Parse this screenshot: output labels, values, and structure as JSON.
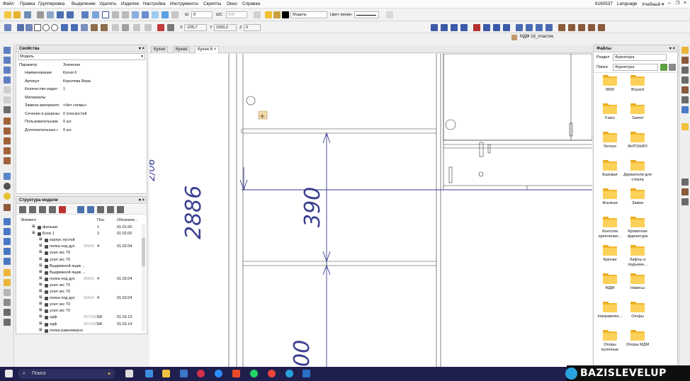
{
  "menu": {
    "items": [
      "Файл",
      "Правка",
      "Группировка",
      "Выделение",
      "Удалить",
      "Изделие",
      "Настройка",
      "Инструменты",
      "Скрипты",
      "Окно",
      "Справка"
    ],
    "license": "6160537",
    "language": "Language",
    "mode": "Учебный",
    "mode_arrow": "▾"
  },
  "toolbar1": {
    "line_width": "8",
    "step_label": "ШС",
    "step_value": "100",
    "layer": "Модель",
    "line_color_label": "Цвет линии"
  },
  "toolbar2": {
    "x_label": "X",
    "x_value": "-225,7",
    "y_label": "Y",
    "y_value": "1593,2",
    "z_label": "Z",
    "z_value": "0",
    "material": "МДФ 18_пластик"
  },
  "properties": {
    "title": "Свойства",
    "selector": "Модель",
    "col_param": "Параметр",
    "col_value": "Значение",
    "rows": [
      {
        "name": "Наименование",
        "value": "Кухня 6"
      },
      {
        "name": "Артикул",
        "value": "Королева Вера"
      },
      {
        "name": "Количество издел",
        "value": "1"
      },
      {
        "name": "Материалы",
        "value": ""
      },
      {
        "name": "Замена материало",
        "value": "<Нет схемы>"
      },
      {
        "name": "Сечения и разрезы",
        "value": "0 плоскостей"
      },
      {
        "name": "Пользовательские",
        "value": "0 шт."
      },
      {
        "name": "Дополнительные г",
        "value": "0 шт."
      }
    ]
  },
  "structure": {
    "title": "Структура модели",
    "col_element": "Элемент",
    "col_pos": "Поз.",
    "col_code": "Обозначе...",
    "rows": [
      {
        "name": "фальши",
        "size": "",
        "qty": "1",
        "code": "01.01.00",
        "indent": 1
      },
      {
        "name": "Блок 1",
        "size": "",
        "qty": "2",
        "code": "01.02.00",
        "indent": 1
      },
      {
        "name": "корпус пустой",
        "size": "",
        "qty": "",
        "code": "",
        "indent": 2
      },
      {
        "name": "полка под дух",
        "size": "568x5",
        "qty": "4",
        "code": "01.02.04",
        "indent": 2
      },
      {
        "name": "усил экс 70",
        "size": "",
        "qty": "",
        "code": "",
        "indent": 2
      },
      {
        "name": "усил экс 70",
        "size": "",
        "qty": "",
        "code": "",
        "indent": 2
      },
      {
        "name": "Выдвижной ящик ...",
        "size": "",
        "qty": "",
        "code": "",
        "indent": 2
      },
      {
        "name": "Выдвижной ящик ...",
        "size": "",
        "qty": "",
        "code": "",
        "indent": 2
      },
      {
        "name": "полка под дух",
        "size": "568x5",
        "qty": "4",
        "code": "01.02.04",
        "indent": 2
      },
      {
        "name": "усил экс 70",
        "size": "",
        "qty": "",
        "code": "",
        "indent": 2
      },
      {
        "name": "усил экс 70",
        "size": "",
        "qty": "",
        "code": "",
        "indent": 2
      },
      {
        "name": "полка под дух",
        "size": "568x5",
        "qty": "4",
        "code": "01.02.04",
        "indent": 2
      },
      {
        "name": "усил экс 70",
        "size": "",
        "qty": "",
        "code": "",
        "indent": 2
      },
      {
        "name": "усил экс 70",
        "size": "",
        "qty": "",
        "code": "",
        "indent": 2
      },
      {
        "name": "хдф",
        "size": "837x589x4",
        "qty": "13",
        "code": "01.02.13",
        "indent": 2
      },
      {
        "name": "хдф",
        "size": "567x589x4",
        "qty": "14",
        "code": "01.02.14",
        "indent": 2
      },
      {
        "name": "полки равномерно",
        "size": "",
        "qty": "",
        "code": "",
        "indent": 2
      }
    ]
  },
  "tabs": [
    "Кухня",
    "Кухня",
    "Кухня 6"
  ],
  "tab_close": "×",
  "drawing": {
    "dim_large": "2886",
    "dim_center": "390",
    "dim_bottom": "00",
    "dim_cut": "2/06"
  },
  "files": {
    "title": "Файлы",
    "section_label": "Раздел",
    "section_value": "Фурнитура",
    "folder_label": "Папка",
    "folder_value": "Фурнитура",
    "folders": [
      "0600",
      "Boyard",
      "Falso",
      "Samet",
      "Sensys",
      "АНТОНИО",
      "Базовая",
      "Держатели для стекла",
      "Жалюзи",
      "Замки",
      "Консоли крепления...",
      "Кроватная фурнитура",
      "Крючки",
      "Лифты и подъемн...",
      "МДМ",
      "Навесы",
      "Направляю...",
      "Опоры",
      "Опоры кухонные",
      "Опоры МДМ"
    ]
  },
  "taskbar": {
    "search": "Поиск"
  },
  "watermark": "BAZISLEVELUP",
  "colors": {
    "accent": "#1f1f4d",
    "folder": "#f6c443",
    "drawing_line": "#3a3f8f",
    "watermark_bg": "#0f0f0f"
  }
}
